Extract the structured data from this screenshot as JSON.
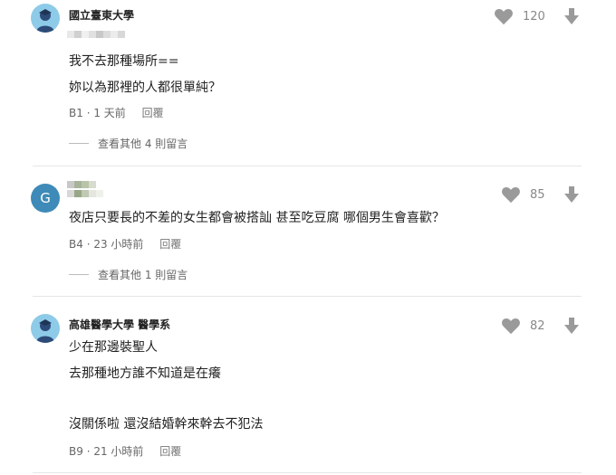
{
  "comments": [
    {
      "author": "國立臺東大學",
      "avatar": "student-avatar-icon",
      "lines": [
        "我不去那種場所==",
        "妳以為那裡的人都很單純？"
      ],
      "floor": "B1",
      "time": "1 天前",
      "reply_label": "回覆",
      "likes": "120",
      "more_replies": "查看其他 4 則留言"
    },
    {
      "author": "",
      "avatar_letter": "G",
      "lines": [
        "夜店只要長的不差的女生都會被搭訕 甚至吃豆腐 哪個男生會喜歡？"
      ],
      "floor": "B4",
      "time": "23 小時前",
      "reply_label": "回覆",
      "likes": "85",
      "more_replies": "查看其他 1 則留言"
    },
    {
      "author": "高雄醫學大學 醫學系",
      "avatar": "student-avatar-icon",
      "lines": [
        "少在那邊裝聖人",
        "去那種地方誰不知道是在癢",
        "",
        "沒關係啦 還沒結婚幹來幹去不犯法"
      ],
      "floor": "B9",
      "time": "21 小時前",
      "reply_label": "回覆",
      "likes": "82"
    }
  ],
  "icons": {
    "like": "heart-icon",
    "dislike": "arrow-down-icon"
  },
  "colors": {
    "avatar_bg": "#8ecbe8",
    "avatar_g_bg": "#3e8ab8",
    "icon_gray": "#9a9a9a"
  }
}
